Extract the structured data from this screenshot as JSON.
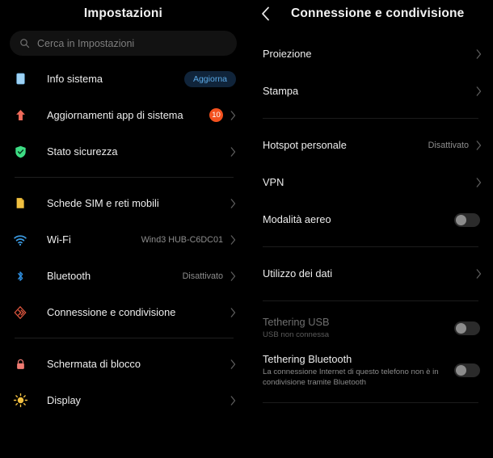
{
  "left": {
    "title": "Impostazioni",
    "search": {
      "placeholder": "Cerca in Impostazioni",
      "value": "",
      "icon": "search-icon"
    },
    "groups": [
      {
        "items": [
          {
            "label": "Info sistema",
            "icon": "phone-info-icon",
            "icon_color": "#9ed3f5",
            "pill": "Aggiorna",
            "chevron": false
          },
          {
            "label": "Aggiornamenti app di sistema",
            "icon": "arrow-up-update-icon",
            "icon_color": "#ef6a5a",
            "badge": "10",
            "chevron": true
          },
          {
            "label": "Stato sicurezza",
            "icon": "shield-check-icon",
            "icon_color": "#3ddc84",
            "chevron": true
          }
        ]
      },
      {
        "items": [
          {
            "label": "Schede SIM e reti mobili",
            "icon": "sim-card-icon",
            "icon_color": "#f0c040",
            "chevron": true
          },
          {
            "label": "Wi-Fi",
            "icon": "wifi-icon",
            "icon_color": "#3b9ae1",
            "value": "Wind3 HUB-C6DC01",
            "chevron": true
          },
          {
            "label": "Bluetooth",
            "icon": "bluetooth-icon",
            "icon_color": "#2f8fe0",
            "value": "Disattivato",
            "chevron": true
          },
          {
            "label": "Connessione e condivisione",
            "icon": "connection-sharing-icon",
            "icon_color": "#e0573f",
            "chevron": true
          }
        ]
      },
      {
        "items": [
          {
            "label": "Schermata di blocco",
            "icon": "lock-icon",
            "icon_color": "#f07b72",
            "chevron": true
          },
          {
            "label": "Display",
            "icon": "brightness-sun-icon",
            "icon_color": "#f5c242",
            "chevron": true
          }
        ]
      }
    ]
  },
  "right": {
    "title": "Connessione e condivisione",
    "back_icon": "back-chevron-icon",
    "groups": [
      {
        "items": [
          {
            "label": "Proiezione",
            "control": "chevron"
          },
          {
            "label": "Stampa",
            "control": "chevron"
          }
        ]
      },
      {
        "items": [
          {
            "label": "Hotspot personale",
            "value": "Disattivato",
            "control": "chevron"
          },
          {
            "label": "VPN",
            "control": "chevron"
          },
          {
            "label": "Modalità aereo",
            "control": "toggle",
            "toggle_on": false
          }
        ]
      },
      {
        "items": [
          {
            "label": "Utilizzo dei dati",
            "control": "chevron"
          }
        ]
      },
      {
        "items": [
          {
            "label": "Tethering USB",
            "sub": "USB non connessa",
            "control": "toggle",
            "toggle_on": false,
            "disabled": true
          },
          {
            "label": "Tethering Bluetooth",
            "sub": "La connessione Internet di questo telefono non è in condivisione tramite Bluetooth",
            "control": "toggle",
            "toggle_on": false
          }
        ]
      }
    ]
  },
  "colors": {
    "background": "#000000",
    "accent_blue": "#5aa9e6",
    "badge_orange": "#f4511e",
    "text_primary": "#ededed",
    "text_secondary": "#8d8d8d"
  }
}
